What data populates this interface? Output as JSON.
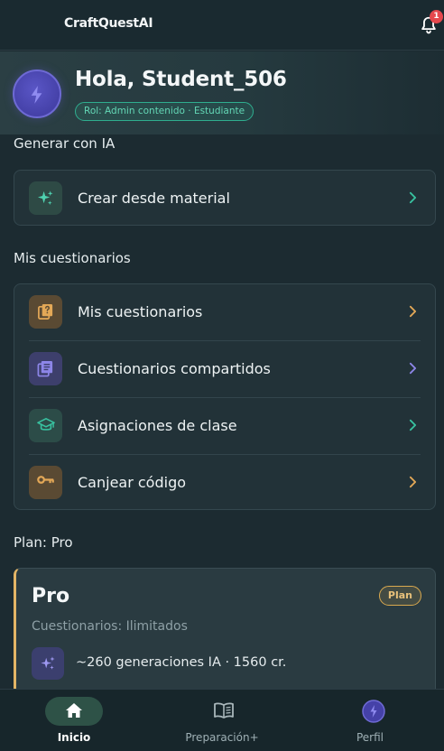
{
  "header": {
    "app_title": "CraftQuestAI",
    "notification_count": "1"
  },
  "profile": {
    "greeting": "Hola, Student_506",
    "role": "Rol: Admin contenido · Estudiante"
  },
  "generate": {
    "section_title": "Generar con IA",
    "create_label": "Crear desde material"
  },
  "quizzes": {
    "section_title": "Mis cuestionarios",
    "items": [
      {
        "label": "Mis cuestionarios",
        "icon": "quiz-icon",
        "color": "#e3a857"
      },
      {
        "label": "Cuestionarios compartidos",
        "icon": "shared-list-icon",
        "color": "#8d86e8"
      },
      {
        "label": "Asignaciones de clase",
        "icon": "graduation-cap-icon",
        "color": "#38c2a0"
      },
      {
        "label": "Canjear código",
        "icon": "key-icon",
        "color": "#e3a857"
      }
    ]
  },
  "plan": {
    "section_title": "Plan: Pro",
    "name": "Pro",
    "badge": "Plan",
    "quota": "Cuestionarios: Ilimitados",
    "generations": "~260 generaciones IA · 1560 cr."
  },
  "nav": {
    "home": "Inicio",
    "prep": "Preparación+",
    "profile": "Perfil"
  },
  "colors": {
    "accent_teal": "#38c2a0",
    "accent_gold": "#e3b566",
    "accent_purple": "#6e6ad4",
    "background": "#1c2b31"
  }
}
